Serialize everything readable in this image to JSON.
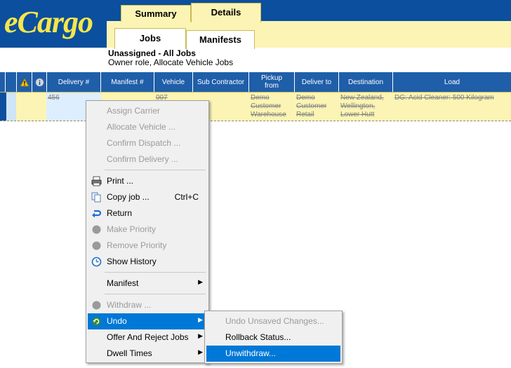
{
  "app": {
    "logo_text": "eCargo"
  },
  "tabs": {
    "top": [
      "Summary",
      "Details"
    ],
    "sub": [
      "Jobs",
      "Manifests"
    ]
  },
  "header": {
    "title": "Unassigned - All Jobs",
    "subtitle": "Owner role, Allocate Vehicle Jobs"
  },
  "grid": {
    "columns": [
      "Delivery #",
      "Manifest #",
      "Vehicle",
      "Sub Contractor",
      "Pickup from",
      "Deliver to",
      "Destination",
      "Load"
    ],
    "row": {
      "delivery": "456",
      "vehicle": "007",
      "pickup": "Demo Customer Warehouse",
      "deliver_to": "Demo Customer Retail",
      "destination": "New Zealand, Wellington, Lower Hutt",
      "load": "DG: Acid Cleaner: 500 Kilogram"
    }
  },
  "context_menu": {
    "items": [
      {
        "label": "Assign Carrier",
        "disabled": true
      },
      {
        "label": "Allocate Vehicle ...",
        "disabled": true
      },
      {
        "label": "Confirm Dispatch ...",
        "disabled": true
      },
      {
        "label": "Confirm Delivery ...",
        "disabled": true
      },
      {
        "label": "Print ...",
        "icon": "printer-icon"
      },
      {
        "label": "Copy job ...",
        "shortcut": "Ctrl+C",
        "icon": "copy-icon"
      },
      {
        "label": "Return",
        "icon": "return-icon"
      },
      {
        "label": "Make Priority",
        "disabled": true,
        "icon": "priority-icon"
      },
      {
        "label": "Remove Priority",
        "disabled": true,
        "icon": "priority-icon"
      },
      {
        "label": "Show History",
        "icon": "history-icon"
      },
      {
        "label": "Manifest",
        "submenu": true
      },
      {
        "label": "Withdraw ...",
        "disabled": true,
        "icon": "withdraw-icon"
      },
      {
        "label": "Undo",
        "submenu": true,
        "highlighted": true,
        "icon": "undo-icon"
      },
      {
        "label": "Offer And Reject Jobs",
        "submenu": true
      },
      {
        "label": "Dwell Times",
        "submenu": true
      }
    ]
  },
  "submenu": {
    "items": [
      {
        "label": "Undo Unsaved Changes...",
        "disabled": true
      },
      {
        "label": "Rollback Status..."
      },
      {
        "label": "Unwithdraw...",
        "highlighted": true
      }
    ]
  },
  "colors": {
    "brand_blue": "#0b4f9e",
    "header_yellow": "#fbf4b4",
    "logo_yellow": "#f7e64a",
    "highlight": "#0078d7"
  }
}
